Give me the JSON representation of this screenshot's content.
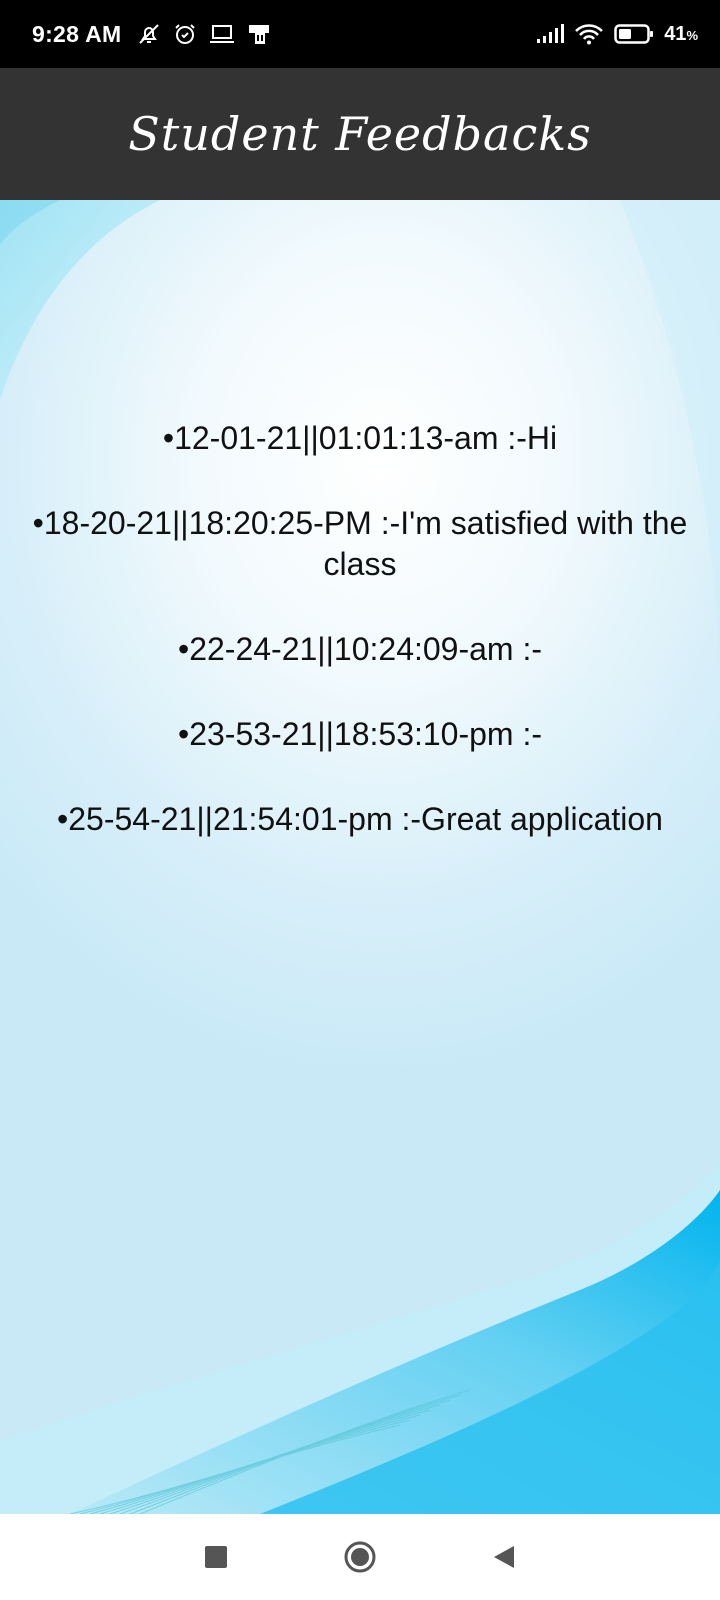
{
  "status_bar": {
    "time": "9:28 AM",
    "left_icons": [
      "bell-off-icon",
      "alarm-icon",
      "laptop-icon",
      "sim-card-icon"
    ],
    "right_icons": [
      "signal-icon",
      "wifi-icon",
      "battery-icon"
    ],
    "battery_percent": "41",
    "battery_unit": "%"
  },
  "header": {
    "title": "Student Feedbacks"
  },
  "feedbacks": [
    "•12-01-21||01:01:13-am :-Hi",
    "•18-20-21||18:20:25-PM :-I'm satisfied with the class",
    "•22-24-21||10:24:09-am :-",
    "•23-53-21||18:53:10-pm :-",
    "•25-54-21||21:54:01-pm :-Great application"
  ],
  "nav_bar": {
    "buttons": [
      "recents-square-icon",
      "home-circle-icon",
      "back-triangle-icon"
    ]
  },
  "colors": {
    "app_bar": "#333333",
    "status_bar": "#000000",
    "wave_accent": "#00b4ee",
    "text": "#111111"
  }
}
